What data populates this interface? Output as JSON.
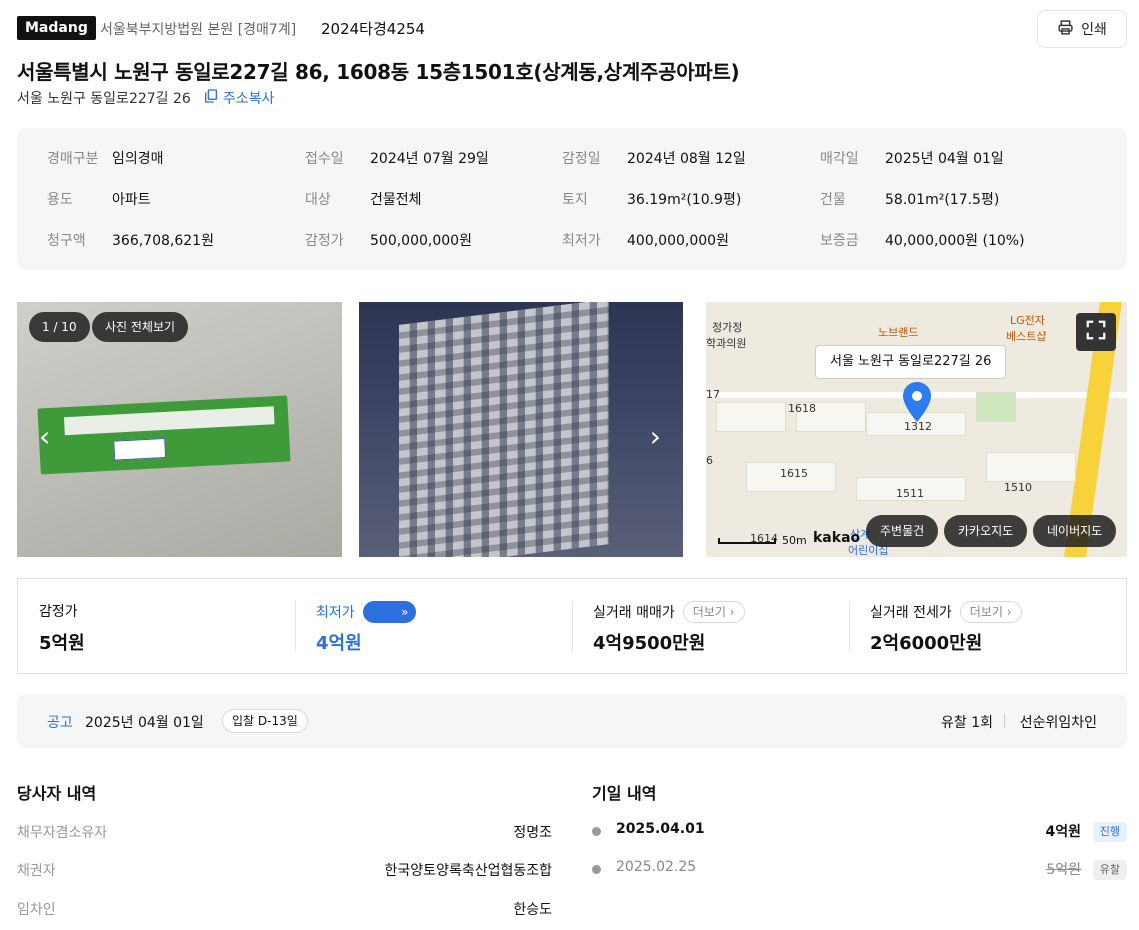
{
  "header": {
    "logo": "Madang",
    "court": "서울북부지방법원 본원 [경매7계]",
    "case_no": "2024타경4254",
    "print_label": "인쇄"
  },
  "property": {
    "title": "서울특별시 노원구 동일로227길 86, 1608동 15층1501호(상계동,상계주공아파트)",
    "road_address": "서울 노원구 동일로227길 26",
    "copy_label": "주소복사"
  },
  "info": [
    {
      "k": "경매구분",
      "v": "임의경매"
    },
    {
      "k": "접수일",
      "v": "2024년 07월 29일"
    },
    {
      "k": "감정일",
      "v": "2024년 08월 12일"
    },
    {
      "k": "매각일",
      "v": "2025년 04월 01일"
    },
    {
      "k": "용도",
      "v": "아파트"
    },
    {
      "k": "대상",
      "v": "건물전체"
    },
    {
      "k": "토지",
      "v": "36.19m²(10.9평)"
    },
    {
      "k": "건물",
      "v": "58.01m²(17.5평)"
    },
    {
      "k": "청구액",
      "v": "366,708,621원"
    },
    {
      "k": "감정가",
      "v": "500,000,000원"
    },
    {
      "k": "최저가",
      "v": "400,000,000원"
    },
    {
      "k": "보증금",
      "v": "40,000,000원 (10%)"
    }
  ],
  "gallery": {
    "counter": "1 / 10",
    "view_all": "사진 전체보기"
  },
  "map": {
    "tooltip": "서울 노원구 동일로227길 26",
    "labels": [
      "정가정",
      "학과의원",
      "노브랜드",
      "LG전자",
      "베스트샵",
      "1618",
      "1312",
      "1615",
      "1511",
      "1510",
      "1614",
      "17",
      "6",
      "상계",
      "어린이집"
    ],
    "scale": "50m",
    "brand": "kakao",
    "chips": [
      "주변물건",
      "카카오지도",
      "네이버지도"
    ]
  },
  "prices": [
    {
      "label": "감정가",
      "value": "5억원"
    },
    {
      "label": "최저가",
      "badge": "20%",
      "value": "4억원"
    },
    {
      "label": "실거래 매매가",
      "more": "더보기",
      "value": "4억9500만원"
    },
    {
      "label": "실거래 전세가",
      "more": "더보기",
      "value": "2억6000만원"
    }
  ],
  "notice": {
    "key": "공고",
    "date": "2025년 04월 01일",
    "dday": "입찰 D-13일",
    "fail_count": "유찰 1회",
    "tenant": "선순위임차인"
  },
  "parties": {
    "title": "당사자 내역",
    "rows": [
      {
        "k": "채무자겸소유자",
        "v": "정명조"
      },
      {
        "k": "채권자",
        "v": "한국양토양록축산업협동조합"
      },
      {
        "k": "임차인",
        "v": "한승도"
      }
    ]
  },
  "dates": {
    "title": "기일 내역",
    "rows": [
      {
        "date": "2025.04.01",
        "price": "4억원",
        "status": "진행"
      },
      {
        "date": "2025.02.25",
        "price": "5억원",
        "status": "유찰"
      }
    ]
  },
  "colors": {
    "accent": "#2b6fe0",
    "panel": "#f5f6f8"
  }
}
